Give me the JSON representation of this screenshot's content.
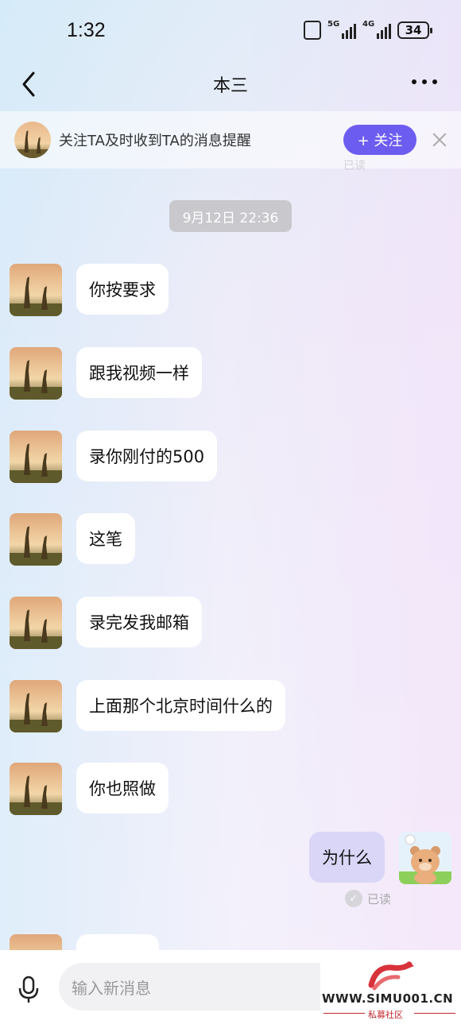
{
  "status_bar": {
    "time": "1:32",
    "network1": "5G",
    "network2": "4G",
    "battery": "34"
  },
  "nav": {
    "title": "本三"
  },
  "follow_banner": {
    "text": "关注TA及时收到TA的消息提醒",
    "button": "+ 关注"
  },
  "faded_read": "已读",
  "timestamp": "9月12日 22:36",
  "messages": [
    {
      "text": "你按要求"
    },
    {
      "text": "跟我视频一样"
    },
    {
      "text": "录你刚付的500"
    },
    {
      "text": "这笔"
    },
    {
      "text": "录完发我邮箱"
    },
    {
      "text": "上面那个北京时间什么的"
    },
    {
      "text": "你也照做"
    }
  ],
  "my_message": {
    "text": "为什么",
    "status": "已读"
  },
  "input": {
    "placeholder": "输入新消息"
  },
  "watermark": {
    "site": "WWW.SIMU001.CN",
    "sub": "私募社区"
  },
  "colors": {
    "accent": "#6d5cf0",
    "my_bubble": "#d9d6f8",
    "stamp": "#c9c8cd"
  }
}
